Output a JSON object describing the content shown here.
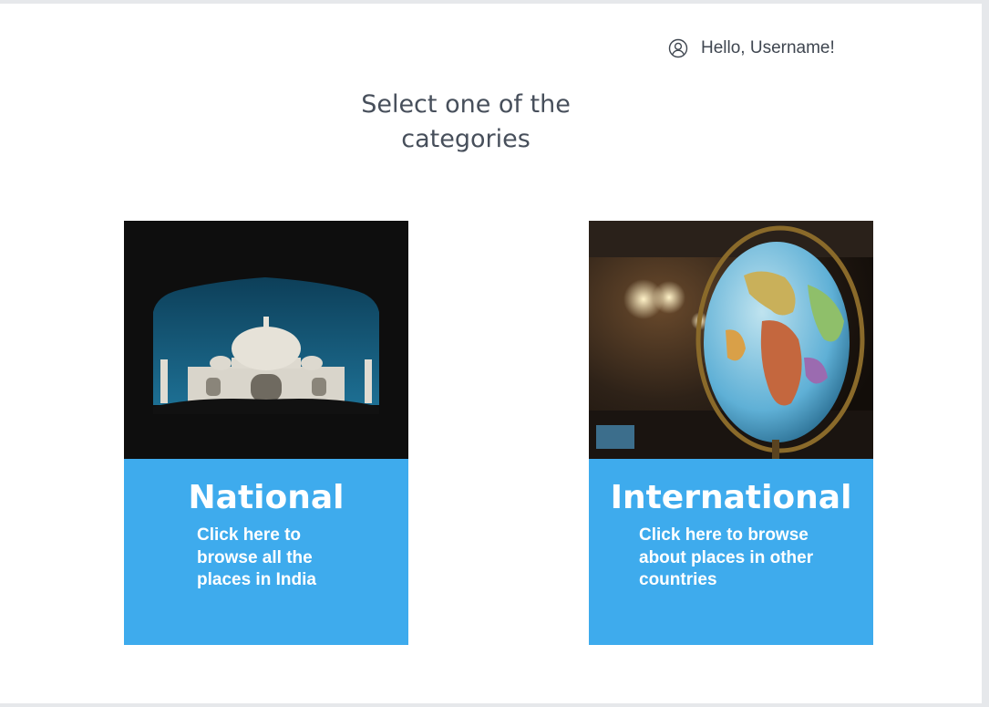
{
  "header": {
    "greeting": "Hello, Username!",
    "user_icon": "user-circle-icon"
  },
  "main": {
    "heading": "Select one of the categories",
    "cards": [
      {
        "title": "National",
        "description": "Click here to browse all the places in India",
        "image": "taj-mahal-photo"
      },
      {
        "title": "International",
        "description": "Click here to browse about places in other countries",
        "image": "globe-photo"
      }
    ]
  },
  "colors": {
    "card_accent": "#3eabed",
    "heading_text": "#474f5b",
    "page_background": "#ffffff"
  }
}
